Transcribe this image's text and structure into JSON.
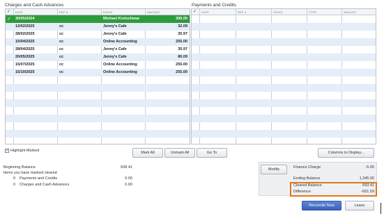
{
  "charges": {
    "title": "Charges and Cash Advances",
    "columns": [
      "DATE",
      "REF #",
      "PAYEE",
      "AMOUNT"
    ],
    "rows": [
      {
        "checked": true,
        "date": "30/05/2024",
        "ref": "",
        "payee": "Michael Kretschmar",
        "amount": "300.00",
        "selected": true
      },
      {
        "checked": false,
        "date": "12/02/2025",
        "ref": "cc",
        "payee": "Jenny's Cafe",
        "amount": "32.09"
      },
      {
        "checked": false,
        "date": "28/02/2025",
        "ref": "cc",
        "payee": "Jenny's Cafe",
        "amount": "35.97"
      },
      {
        "checked": false,
        "date": "15/04/2025",
        "ref": "cc",
        "payee": "Online Accounting",
        "amount": "255.00"
      },
      {
        "checked": false,
        "date": "28/04/2025",
        "ref": "cc",
        "payee": "Jenny's Cafe",
        "amount": "35.97"
      },
      {
        "checked": false,
        "date": "20/05/2025",
        "ref": "cc",
        "payee": "Jenny's Cafe",
        "amount": "80.09"
      },
      {
        "checked": false,
        "date": "15/07/2025",
        "ref": "cc",
        "payee": "Online Accounting",
        "amount": "255.00"
      },
      {
        "checked": false,
        "date": "15/10/2025",
        "ref": "cc",
        "payee": "Online Accounting",
        "amount": "255.00"
      }
    ]
  },
  "payments": {
    "title": "Payments and Credits",
    "columns": [
      "DATE",
      "REF #",
      "PAYEE",
      "TYPE",
      "AMOUNT"
    ]
  },
  "toolbar": {
    "highlight_marked": "Highlight Marked",
    "highlight_marked_checked": true,
    "mark_all": "Mark All",
    "unmark_all": "Unmark All",
    "go_to": "Go To",
    "columns_to_display": "Columns to Display..."
  },
  "balances": {
    "beginning_label": "Beginning Balance",
    "beginning_value": "608.41",
    "items_marked_label": "Items you have marked cleared",
    "payments_count": "0",
    "payments_label": "Payments and Credits",
    "payments_value": "0.00",
    "charges_count": "0",
    "charges_label": "Charges and Cash Advances",
    "charges_value": "0.00"
  },
  "summary": {
    "modify": "Modify",
    "finance_charge_label": "Finance Charge",
    "finance_charge_value": "-5.00",
    "ending_balance_label": "Ending Balance",
    "ending_balance_value": "1,345.00",
    "cleared_balance_label": "Cleared Balance",
    "cleared_balance_value": "693.41",
    "difference_label": "Difference",
    "difference_value": "-651.59"
  },
  "actions": {
    "reconcile_now": "Reconcile Now",
    "leave": "Leave"
  },
  "colors": {
    "selected_row": "#2e9b3a",
    "alt_row": "#e4edf8",
    "highlight_border": "#e2771a",
    "primary_button": "#3a63b8"
  }
}
